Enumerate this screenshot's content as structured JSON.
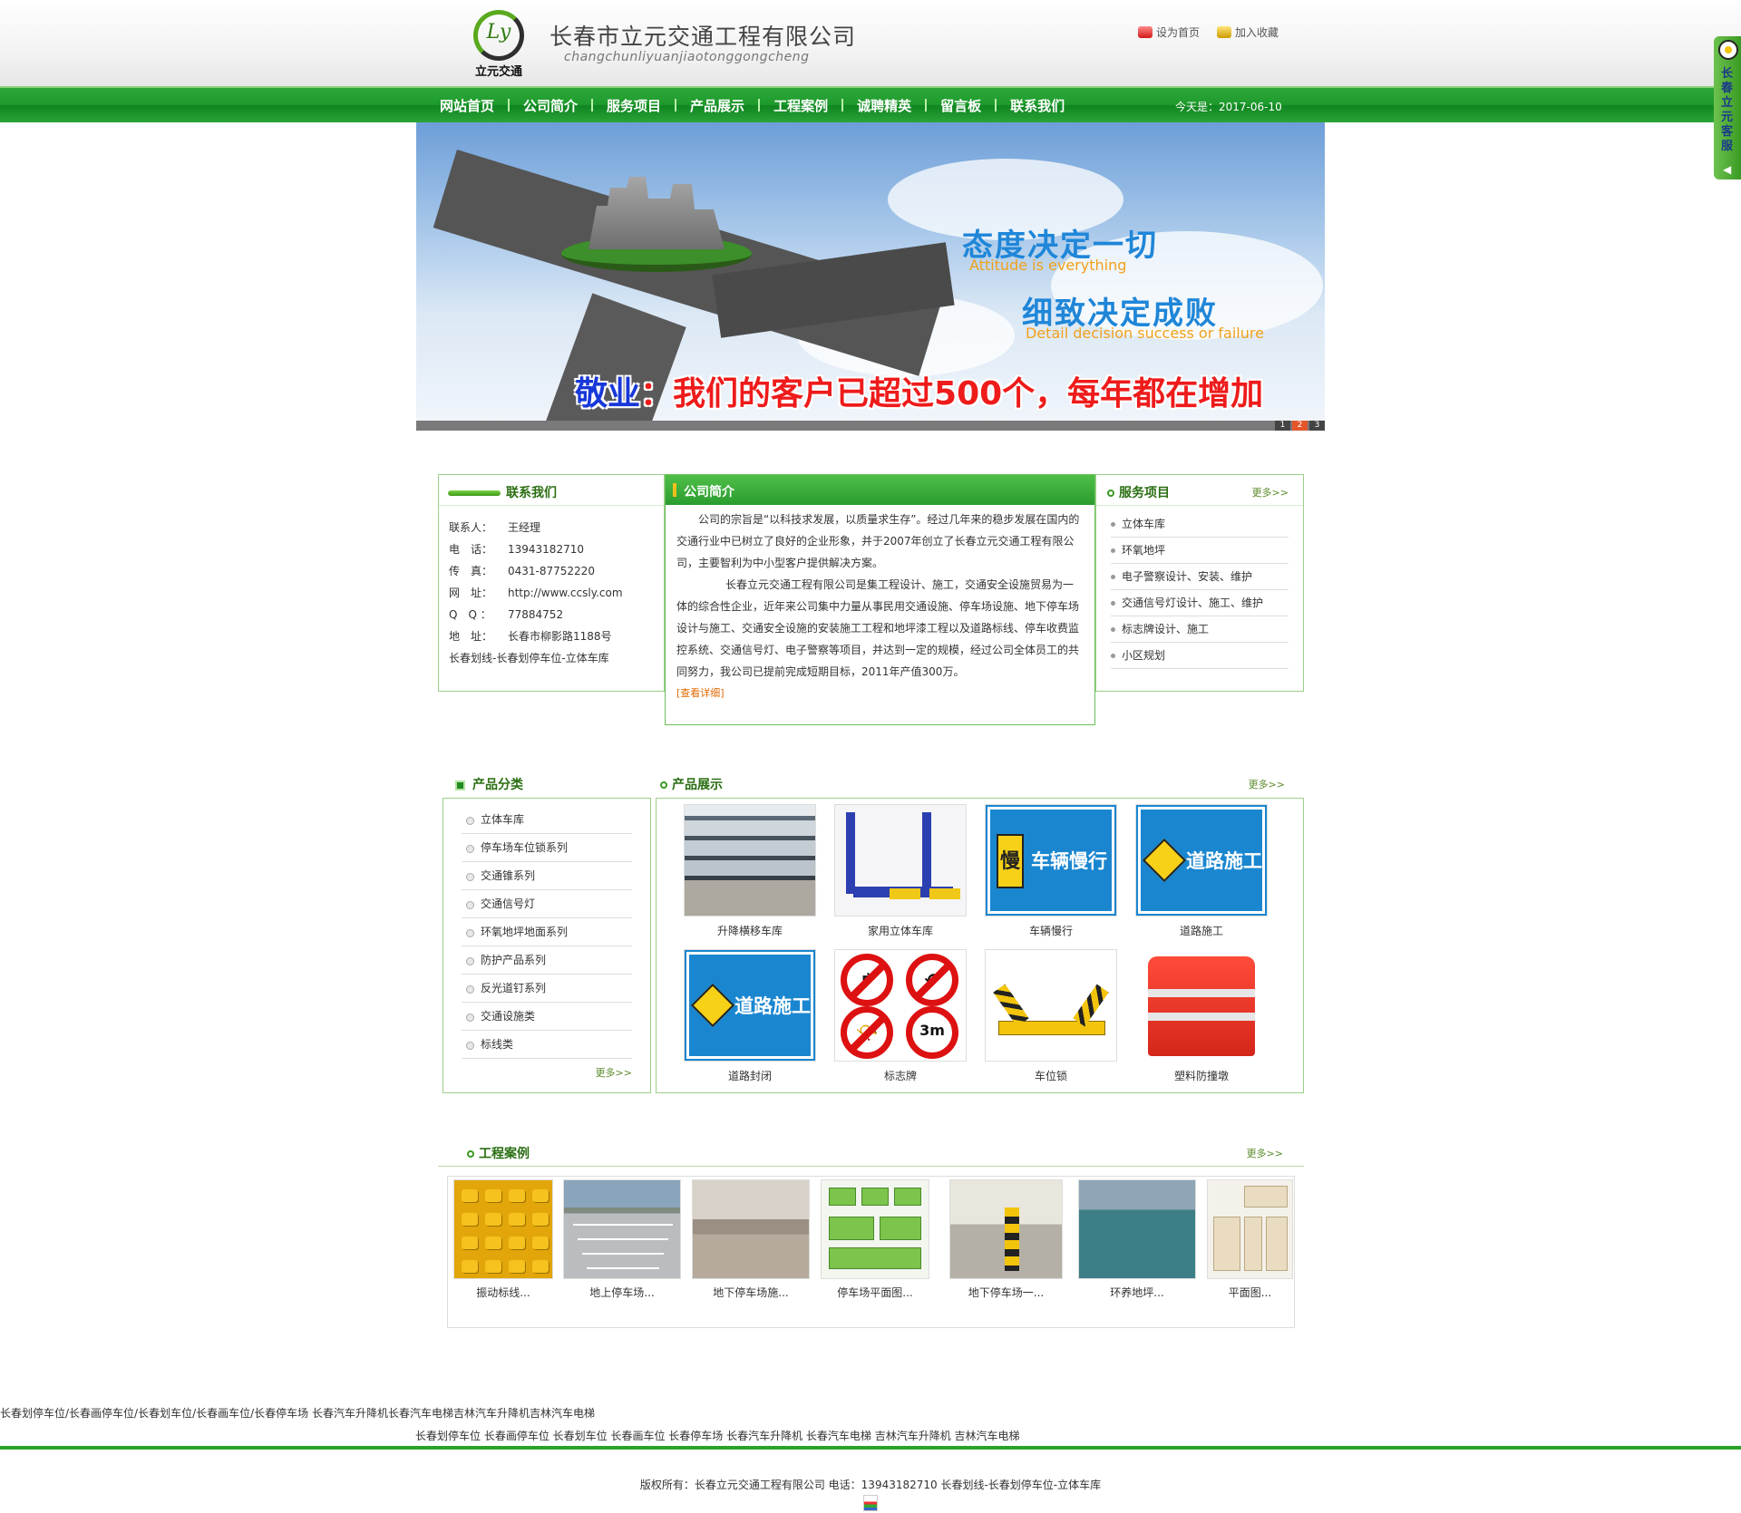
{
  "header": {
    "logo_monogram": "Ly",
    "logo_text": "立元交通",
    "company_name": "长春市立元交通工程有限公司",
    "company_pinyin": "changchunliyuanjiaotonggongcheng",
    "set_home": "设为首页",
    "add_favorite": "加入收藏"
  },
  "nav": {
    "items": [
      "网站首页",
      "公司简介",
      "服务项目",
      "产品展示",
      "工程案例",
      "诚聘精英",
      "留言板",
      "联系我们"
    ],
    "date": "今天是：2017-06-10"
  },
  "banner": {
    "slogan1_cn": "态度决定一切",
    "slogan1_en": "Attitude is everything",
    "slogan2_cn": "细致决定成败",
    "slogan2_en": "Detail decision success or failure",
    "bottom_prefix": "敬业",
    "bottom_text": "：我们的客户已超过500个，每年都在增加",
    "pages": [
      "1",
      "2",
      "3"
    ],
    "active_page": "2"
  },
  "contact": {
    "title": "联系我们",
    "lines": [
      {
        "k": "联系人：",
        "v": "王经理"
      },
      {
        "k": "电　话：",
        "v": "13943182710"
      },
      {
        "k": "传　真：",
        "v": "0431-87752220"
      },
      {
        "k": "网　址：",
        "v": "http://www.ccsly.com"
      },
      {
        "k": "Q　Q ：",
        "v": "77884752"
      },
      {
        "k": "地　址：",
        "v": "长春市柳影路1188号"
      }
    ],
    "footer_text": "长春划线-长春划停车位-立体车库"
  },
  "about": {
    "title": "公司简介",
    "p1": "公司的宗旨是“以科技求发展，以质量求生存”。经过几年来的稳步发展在国内的交通行业中已树立了良好的企业形象，并于2007年创立了长春立元交通工程有限公司，主要智利为中小型客户提供解决方案。",
    "p2": "长春立元交通工程有限公司是集工程设计、施工，交通安全设施贸易为一体的综合性企业，近年来公司集中力量从事民用交通设施、停车场设施、地下停车场设计与施工、交通安全设施的安装施工工程和地坪漆工程以及道路标线、停车收费监控系统、交通信号灯、电子警察等项目，并达到一定的规模，经过公司全体员工的共同努力，我公司已提前完成短期目标，2011年产值300万。",
    "more": "[查看详细]"
  },
  "service": {
    "title": "服务项目",
    "more": "更多>>",
    "items": [
      "立体车库",
      "环氧地坪",
      "电子警察设计、安装、维护",
      "交通信号灯设计、施工、维护",
      "标志牌设计、施工",
      "小区规划"
    ]
  },
  "category": {
    "title": "产品分类",
    "more": "更多>>",
    "items": [
      "立体车库",
      "停车场车位锁系列",
      "交通锥系列",
      "交通信号灯",
      "环氧地坪地面系列",
      "防护产品系列",
      "反光道钉系列",
      "交通设施类",
      "标线类"
    ]
  },
  "products": {
    "title": "产品展示",
    "more": "更多>>",
    "items": [
      {
        "name": "升降横移车库",
        "img": "garage"
      },
      {
        "name": "家用立体车库",
        "img": "lift"
      },
      {
        "name": "车辆慢行",
        "img": "sign-slow"
      },
      {
        "name": "道路施工",
        "img": "sign-work"
      },
      {
        "name": "道路封闭",
        "img": "sign-work"
      },
      {
        "name": "标志牌",
        "img": "prohibit-signs"
      },
      {
        "name": "车位锁",
        "img": "parking-lock"
      },
      {
        "name": "塑料防撞墩",
        "img": "barrier"
      }
    ],
    "sign_slow_text": "车辆慢行",
    "sign_slow_char": "慢",
    "sign_work_text": "道路施工",
    "limit_text": "3m"
  },
  "cases": {
    "title": "工程案例",
    "more": "更多>>",
    "items": [
      "振动标线...",
      "地上停车场...",
      "地下停车场施...",
      "停车场平面图...",
      "地下停车场一...",
      "环养地坪...",
      "平面图..."
    ]
  },
  "footer": {
    "seo_line1": "长春划停车位/长春画停车位/长春划车位/长春画车位/长春停车场  长春汽车升降机长春汽车电梯吉林汽车升降机吉林汽车电梯",
    "seo_line2": "长春划停车位 长春画停车位 长春划车位 长春画车位 长春停车场 长春汽车升降机 长春汽车电梯 吉林汽车升降机 吉林汽车电梯",
    "copyright": "版权所有：长春立元交通工程有限公司  电话：13943182710  长春划线-长春划停车位-立体车库"
  },
  "float_service": {
    "label": "长春立元客服"
  },
  "colors": {
    "brand_green": "#1e9b2c",
    "panel_border": "#9ccf8a",
    "title_green": "#2a6e12",
    "accent_orange": "#e06a00"
  }
}
